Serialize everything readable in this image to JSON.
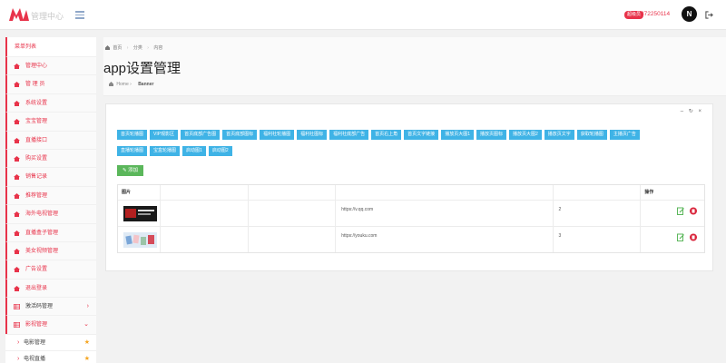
{
  "header": {
    "brand": "管理中心",
    "admin_badge": "超级员",
    "user_id": "372250114",
    "avatar_letter": "N"
  },
  "sidebar": {
    "title": "菜单列表",
    "items": [
      {
        "label": "管理中心"
      },
      {
        "label": "管 理 员"
      },
      {
        "label": "系统设置"
      },
      {
        "label": "宝宝管理"
      },
      {
        "label": "直播接口"
      },
      {
        "label": "购买设置"
      },
      {
        "label": "销售记录"
      },
      {
        "label": "推荐管理"
      },
      {
        "label": "海外电视管理"
      },
      {
        "label": "直播盒子管理"
      },
      {
        "label": "美女视频管理"
      },
      {
        "label": "广告设置"
      },
      {
        "label": "退出登录"
      }
    ],
    "groups": [
      {
        "label": "激活码管理",
        "chevron": "›"
      },
      {
        "label": "影视管理",
        "chevron": "⌄"
      }
    ],
    "sub_items": [
      {
        "label": "电影管理",
        "arrow": "›",
        "star": "★"
      },
      {
        "label": "电视直播",
        "arrow": "›",
        "star": "★"
      }
    ]
  },
  "breadcrumb": {
    "items": [
      "首页",
      "分类",
      "内容"
    ],
    "separator": "›"
  },
  "page": {
    "title": "app设置管理",
    "home_label": "Home",
    "current_label": "Banner"
  },
  "panel": {
    "tools": "– ↻ ×",
    "category_row1": [
      "首页轮播图",
      "VIP观影区",
      "首页底部广告图",
      "首页底部图标",
      "福利社轮播图",
      "福利社图标",
      "福利社底部广告",
      "首页右上角",
      "首页文字链接",
      "播放页大图1",
      "播放页图标",
      "播放页大图2",
      "播放页文字",
      "获取轮播图",
      "主播页广告"
    ],
    "category_row2": [
      "直播轮播图",
      "宝盒轮播图",
      "启动图1",
      "启动图2"
    ],
    "add_label": "添加",
    "table": {
      "columns": [
        "图片",
        "",
        "",
        "",
        "",
        "操作"
      ],
      "rows": [
        {
          "link": "https://v.qq.com",
          "order": "2"
        },
        {
          "link": "https://youku.com",
          "order": "3"
        }
      ]
    }
  },
  "colors": {
    "accent_red": "#e8334a",
    "info_blue": "#3fb3e6",
    "success_green": "#5bb75b"
  }
}
